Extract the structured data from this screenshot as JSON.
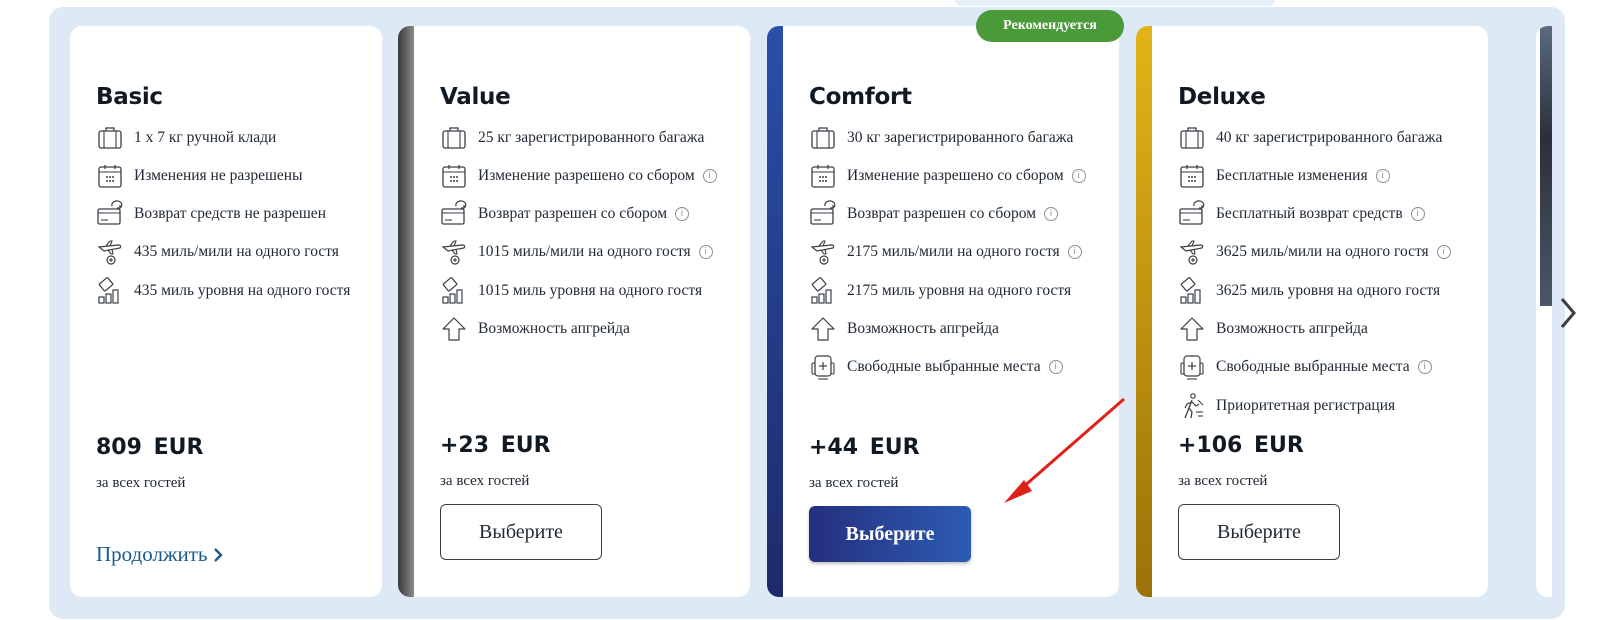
{
  "recommended_badge": "Рекомендуется",
  "colors": {
    "value_accent": "#5a5a5a",
    "comfort_accent": "#263a8c",
    "deluxe_accent": "#c49a10",
    "primary_button": "#2d4ea0",
    "badge": "#4a9a3a",
    "link": "#1a5a8c"
  },
  "cards": [
    {
      "title": "Basic",
      "features": [
        {
          "icon": "baggage-icon",
          "text": "1 x 7 кг ручной клади",
          "info": false
        },
        {
          "icon": "calendar-icon",
          "text": "Изменения не разрешены",
          "info": false
        },
        {
          "icon": "refund-icon",
          "text": "Возврат средств не разрешен",
          "info": false
        },
        {
          "icon": "plane-miles-icon",
          "text": "435 миль/мили на одного гостя",
          "info": false
        },
        {
          "icon": "tier-miles-icon",
          "text": "435 миль уровня на одного гостя",
          "info": false
        }
      ],
      "price": "809 EUR",
      "per_guest": "за всех гостей",
      "action": "Продолжить"
    },
    {
      "title": "Value",
      "features": [
        {
          "icon": "baggage-icon",
          "text": "25 кг зарегистрированного багажа",
          "info": false
        },
        {
          "icon": "calendar-icon",
          "text": "Изменение разрешено со сбором",
          "info": true
        },
        {
          "icon": "refund-icon",
          "text": "Возврат разрешен со сбором",
          "info": true
        },
        {
          "icon": "plane-miles-icon",
          "text": "1015 миль/мили на одного гостя",
          "info": true
        },
        {
          "icon": "tier-miles-icon",
          "text": "1015 миль уровня на одного гостя",
          "info": false
        },
        {
          "icon": "upgrade-icon",
          "text": "Возможность апгрейда",
          "info": false
        }
      ],
      "price": "+23 EUR",
      "per_guest": "за всех гостей",
      "action": "Выберите"
    },
    {
      "title": "Comfort",
      "features": [
        {
          "icon": "baggage-icon",
          "text": "30 кг зарегистрированного багажа",
          "info": false
        },
        {
          "icon": "calendar-icon",
          "text": "Изменение разрешено со сбором",
          "info": true
        },
        {
          "icon": "refund-icon",
          "text": "Возврат разрешен со сбором",
          "info": true
        },
        {
          "icon": "plane-miles-icon",
          "text": "2175 миль/мили на одного гостя",
          "info": true
        },
        {
          "icon": "tier-miles-icon",
          "text": "2175 миль уровня на одного гостя",
          "info": false
        },
        {
          "icon": "upgrade-icon",
          "text": "Возможность апгрейда",
          "info": false
        },
        {
          "icon": "seat-icon",
          "text": "Свободные выбранные места",
          "info": true
        }
      ],
      "price": "+44 EUR",
      "per_guest": "за всех гостей",
      "action": "Выберите"
    },
    {
      "title": "Deluxe",
      "features": [
        {
          "icon": "baggage-icon",
          "text": "40 кг зарегистрированного багажа",
          "info": false
        },
        {
          "icon": "calendar-icon",
          "text": "Бесплатные изменения",
          "info": true
        },
        {
          "icon": "refund-icon",
          "text": "Бесплатный возврат средств",
          "info": true
        },
        {
          "icon": "plane-miles-icon",
          "text": "3625 миль/мили на одного гостя",
          "info": true
        },
        {
          "icon": "tier-miles-icon",
          "text": "3625 миль уровня на одного гостя",
          "info": false
        },
        {
          "icon": "upgrade-icon",
          "text": "Возможность апгрейда",
          "info": false
        },
        {
          "icon": "seat-icon",
          "text": "Свободные выбранные места",
          "info": true
        },
        {
          "icon": "priority-checkin-icon",
          "text": "Приоритетная регистрация",
          "info": false
        }
      ],
      "price": "+106 EUR",
      "per_guest": "за всех гостей",
      "action": "Выберите"
    }
  ]
}
